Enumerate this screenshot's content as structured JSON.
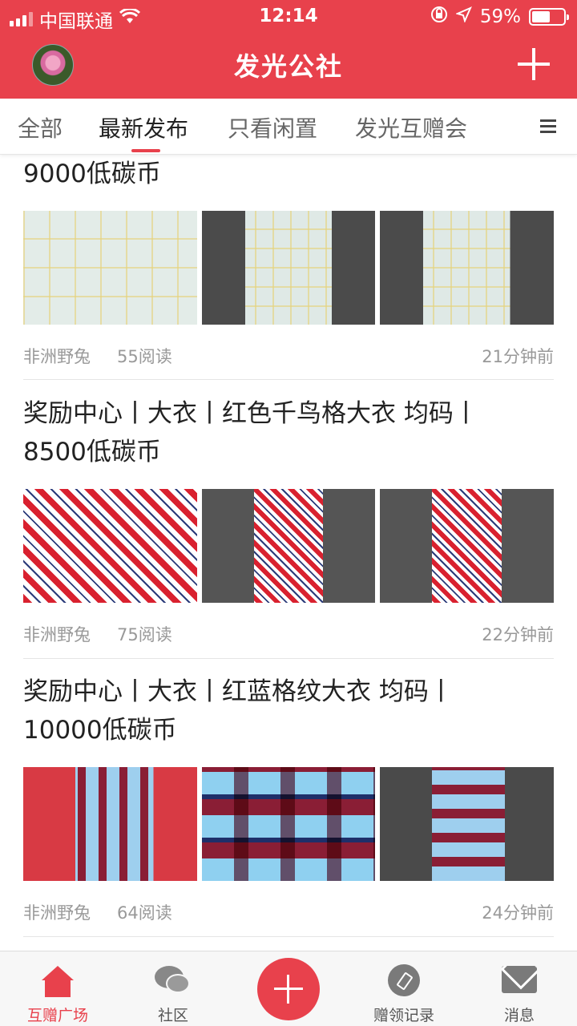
{
  "status_bar": {
    "carrier": "中国联通",
    "time": "12:14",
    "battery_text": "59%",
    "battery_level": 0.59
  },
  "header": {
    "title": "发光公社",
    "avatar_icon": "lotus-avatar",
    "add_icon": "plus-icon",
    "accent_color": "#e8414c"
  },
  "tabs": [
    {
      "label": "全部"
    },
    {
      "label": "最新发布",
      "active": true
    },
    {
      "label": "只看闲置"
    },
    {
      "label": "发光互赠会"
    }
  ],
  "posts": [
    {
      "title_lines": [
        "9000低碳币"
      ],
      "author": "非洲野兔",
      "reads": "55阅读",
      "time": "21分钟前"
    },
    {
      "title_lines": [
        "奖励中心丨大衣丨红色千鸟格大衣 均码丨",
        "8500低碳币"
      ],
      "author": "非洲野兔",
      "reads": "75阅读",
      "time": "22分钟前"
    },
    {
      "title_lines": [
        "奖励中心丨大衣丨红蓝格纹大衣 均码丨",
        "10000低碳币"
      ],
      "author": "非洲野兔",
      "reads": "64阅读",
      "time": "24分钟前"
    }
  ],
  "bottom_nav": [
    {
      "label": "互赠广场",
      "icon": "home-icon",
      "active": true
    },
    {
      "label": "社区",
      "icon": "chat-bubbles-icon"
    },
    {
      "label": "",
      "icon": "plus-icon"
    },
    {
      "label": "赠领记录",
      "icon": "compass-icon"
    },
    {
      "label": "消息",
      "icon": "mail-icon"
    }
  ]
}
